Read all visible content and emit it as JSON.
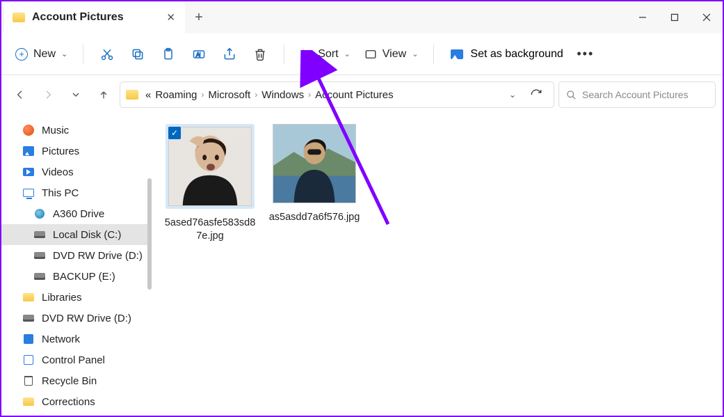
{
  "tab": {
    "title": "Account Pictures"
  },
  "toolbar": {
    "new_label": "New",
    "sort_label": "Sort",
    "view_label": "View",
    "background_label": "Set as background"
  },
  "breadcrumb": {
    "items": [
      "Roaming",
      "Microsoft",
      "Windows",
      "Account Pictures"
    ]
  },
  "search": {
    "placeholder": "Search Account Pictures"
  },
  "sidebar": {
    "items": [
      {
        "label": "Music"
      },
      {
        "label": "Pictures"
      },
      {
        "label": "Videos"
      },
      {
        "label": "This PC"
      },
      {
        "label": "A360 Drive"
      },
      {
        "label": "Local Disk (C:)"
      },
      {
        "label": "DVD RW Drive (D:)"
      },
      {
        "label": "BACKUP (E:)"
      },
      {
        "label": "Libraries"
      },
      {
        "label": "DVD RW Drive (D:)"
      },
      {
        "label": "Network"
      },
      {
        "label": "Control Panel"
      },
      {
        "label": "Recycle Bin"
      },
      {
        "label": "Corrections"
      }
    ]
  },
  "files": [
    {
      "name": "5ased76asfe583sd87e.jpg",
      "selected": true
    },
    {
      "name": "as5asdd7a6f576.jpg",
      "selected": false
    }
  ]
}
